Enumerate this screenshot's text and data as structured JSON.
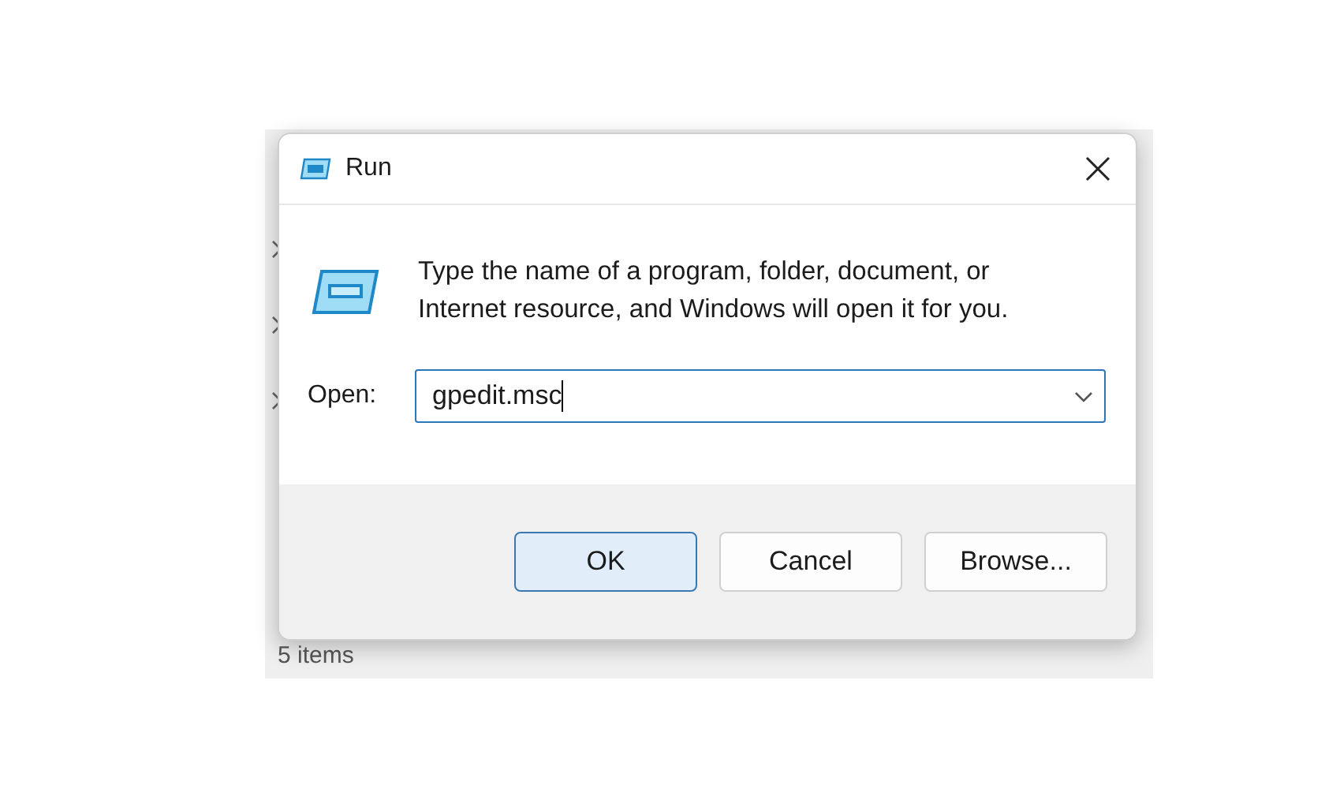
{
  "background": {
    "status": "5 items"
  },
  "window": {
    "title": "Run"
  },
  "message": "Type the name of a program, folder, document, or Internet resource, and Windows will open it for you.",
  "open_field": {
    "label": "Open:",
    "value": "gpedit.msc"
  },
  "buttons": [
    {
      "label": "OK",
      "default": true
    },
    {
      "label": "Cancel",
      "default": false
    },
    {
      "label": "Browse...",
      "default": false
    }
  ]
}
